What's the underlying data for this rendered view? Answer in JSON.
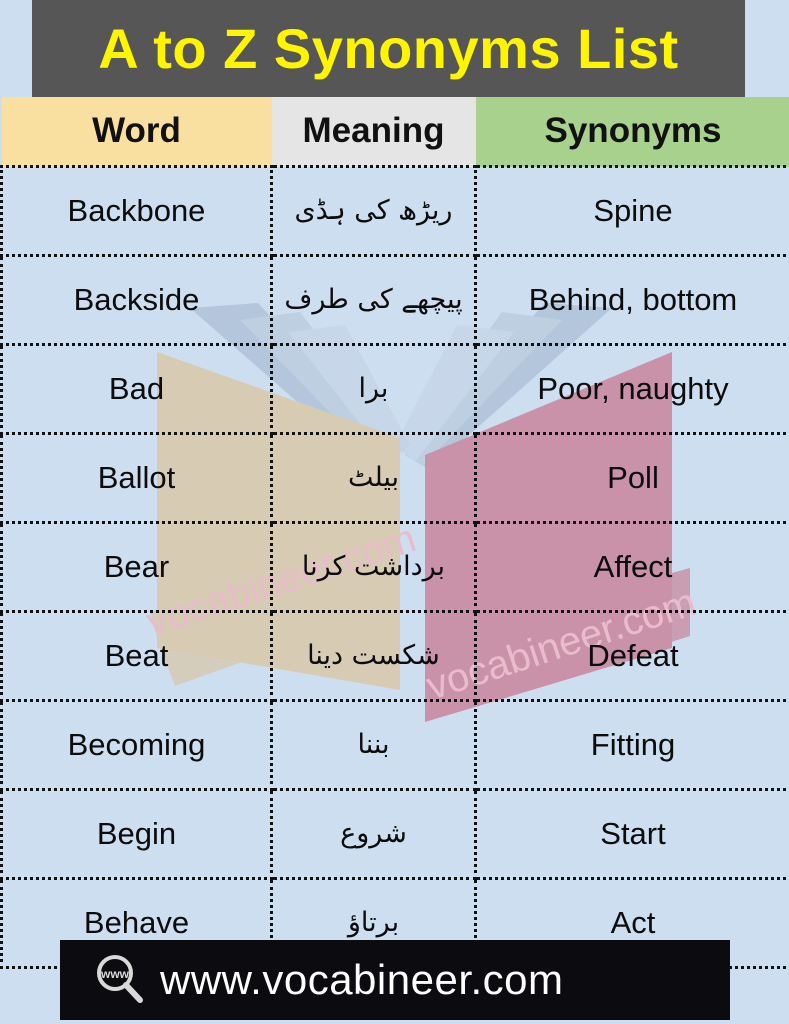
{
  "header": {
    "title": "A to Z Synonyms List",
    "title_bg": "#565656",
    "title_color": "#fff500"
  },
  "table": {
    "columns": [
      {
        "label": "Word",
        "bg": "#fae0a0"
      },
      {
        "label": "Meaning",
        "bg": "#e5e5e5"
      },
      {
        "label": "Synonyms",
        "bg": "#a8d18d"
      }
    ],
    "rows": [
      {
        "word": "Backbone",
        "meaning": "ریڑھ کی ہڈی",
        "synonyms": "Spine"
      },
      {
        "word": "Backside",
        "meaning": "پیچھے کی طرف",
        "synonyms": "Behind, bottom"
      },
      {
        "word": "Bad",
        "meaning": "برا",
        "synonyms": "Poor, naughty"
      },
      {
        "word": "Ballot",
        "meaning": "بیلٹ",
        "synonyms": "Poll"
      },
      {
        "word": "Bear",
        "meaning": "برداشت کرنا",
        "synonyms": "Affect"
      },
      {
        "word": "Beat",
        "meaning": "شکست دینا",
        "synonyms": "Defeat"
      },
      {
        "word": "Becoming",
        "meaning": "بننا",
        "synonyms": "Fitting"
      },
      {
        "word": "Begin",
        "meaning": "شروع",
        "synonyms": "Start"
      },
      {
        "word": "Behave",
        "meaning": "برتاؤ",
        "synonyms": "Act"
      }
    ]
  },
  "watermark": {
    "text": "vocabineer.com",
    "color": "#e9bccb"
  },
  "footer": {
    "url": "www.vocabineer.com",
    "icon_label": "www",
    "bg": "#0b0b10"
  },
  "page": {
    "background": "#cddef0",
    "cell_background": "#cddef0"
  }
}
